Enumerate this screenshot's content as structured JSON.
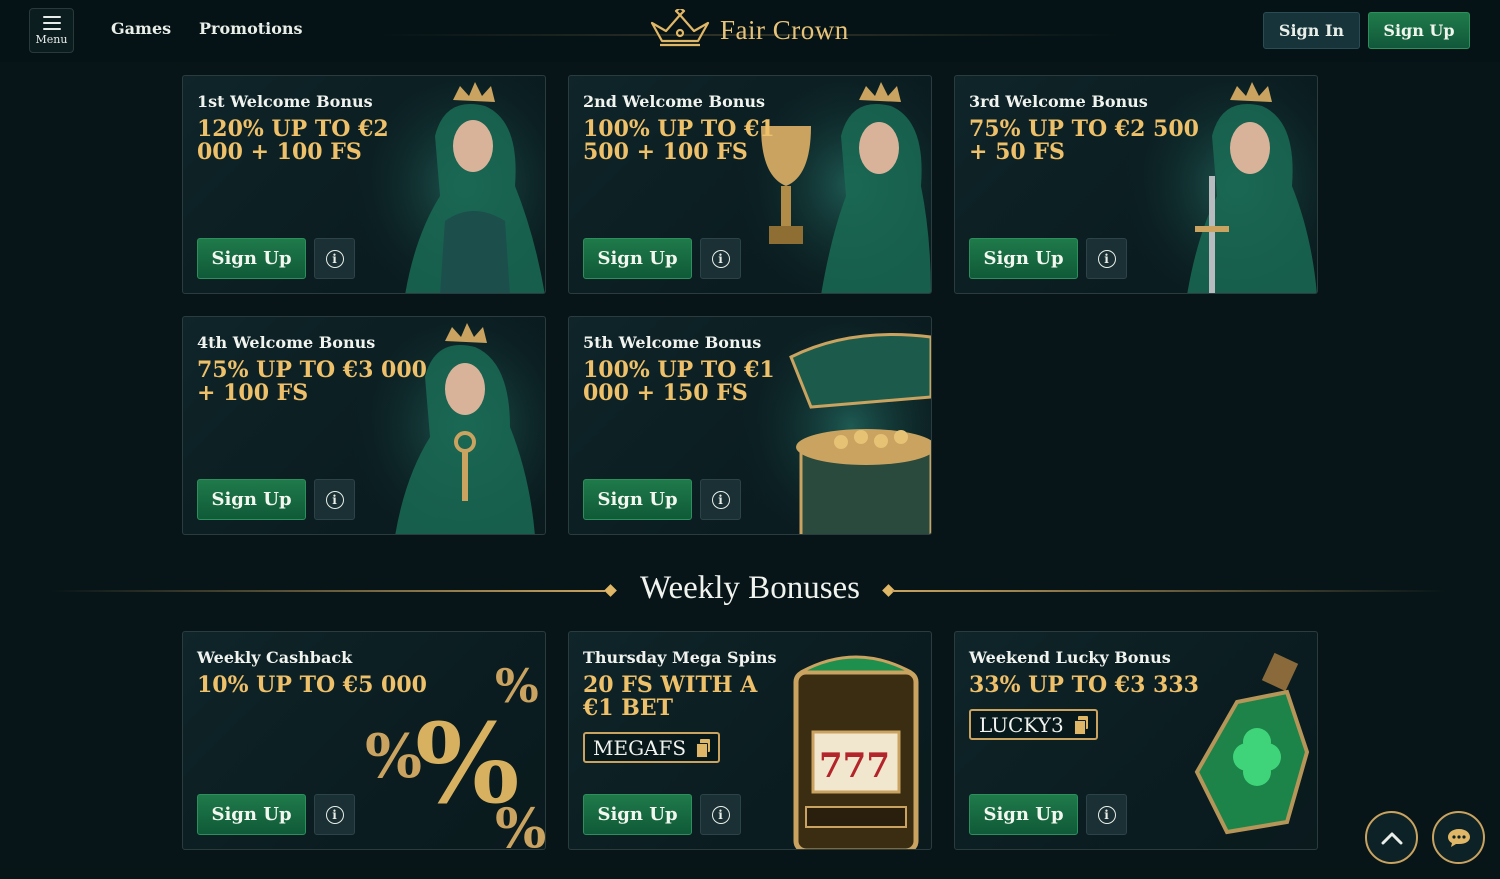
{
  "header": {
    "menu_label": "Menu",
    "nav": [
      "Games",
      "Promotions"
    ],
    "logo_text": "Fair Crown",
    "sign_in": "Sign In",
    "sign_up": "Sign Up"
  },
  "welcome_bonuses": [
    {
      "title": "1st Welcome Bonus",
      "offer": "120% UP TO €2 000 + 100 FS",
      "cta": "Sign Up"
    },
    {
      "title": "2nd Welcome Bonus",
      "offer": "100% UP TO €1 500 + 100 FS",
      "cta": "Sign Up"
    },
    {
      "title": "3rd Welcome Bonus",
      "offer": "75% UP TO €2 500 + 50 FS",
      "cta": "Sign Up"
    },
    {
      "title": "4th Welcome Bonus",
      "offer": "75% UP TO €3 000 + 100 FS",
      "cta": "Sign Up"
    },
    {
      "title": "5th Welcome Bonus",
      "offer": "100% UP TO €1 000 + 150 FS",
      "cta": "Sign Up"
    }
  ],
  "weekly_section_title": "Weekly Bonuses",
  "weekly_bonuses": [
    {
      "title": "Weekly Cashback",
      "offer": "10% UP TO €5 000",
      "cta": "Sign Up"
    },
    {
      "title": "Thursday Mega Spins",
      "offer": "20 FS WITH A €1 BET",
      "code": "MEGAFS",
      "cta": "Sign Up"
    },
    {
      "title": "Weekend Lucky Bonus",
      "offer": "33% UP TO €3 333",
      "code": "LUCKY3",
      "cta": "Sign Up"
    }
  ],
  "info_glyph": "i",
  "colors": {
    "background": "#071518",
    "gold": "#eec069",
    "green_button": "#1f7a4a"
  }
}
